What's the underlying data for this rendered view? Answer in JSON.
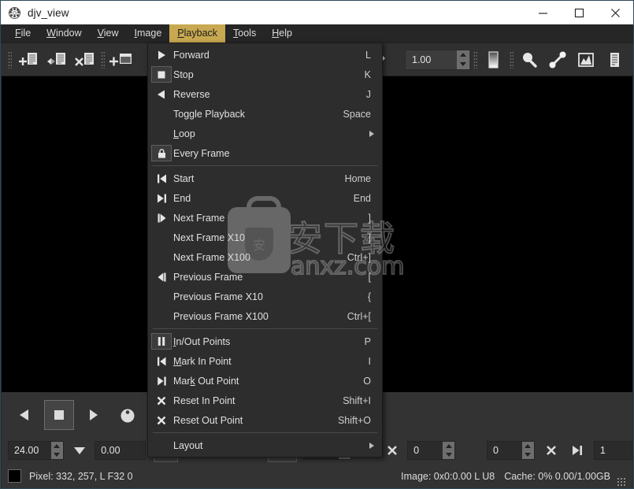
{
  "window": {
    "title": "djv_view",
    "icon": "film-reel-icon",
    "minimize_label": "—",
    "maximize_label": "□",
    "close_label": "✕"
  },
  "menubar": {
    "items": [
      {
        "label": "File",
        "mnemonic": "F",
        "active": false
      },
      {
        "label": "Window",
        "mnemonic": "W",
        "active": false
      },
      {
        "label": "View",
        "mnemonic": "V",
        "active": false
      },
      {
        "label": "Image",
        "mnemonic": "I",
        "active": false
      },
      {
        "label": "Playback",
        "mnemonic": "P",
        "active": true
      },
      {
        "label": "Tools",
        "mnemonic": "T",
        "active": false
      },
      {
        "label": "Help",
        "mnemonic": "H",
        "active": false
      }
    ]
  },
  "toolbar": {
    "zoom_value": "1.00",
    "buttons": [
      {
        "name": "add-file-icon"
      },
      {
        "name": "reload-file-icon"
      },
      {
        "name": "close-file-icon"
      },
      {
        "name": "new-window-icon"
      },
      {
        "name": "color-picker-icon"
      },
      {
        "name": "gradient-icon"
      },
      {
        "name": "magnify-icon"
      },
      {
        "name": "color-pick-tool-icon"
      },
      {
        "name": "histogram-icon"
      },
      {
        "name": "info-icon"
      }
    ]
  },
  "playback_menu": {
    "items": [
      {
        "label": "Forward",
        "shortcut": "L",
        "icon": "play-forward-icon",
        "mnemonic": "",
        "boxed": false,
        "submenu": false
      },
      {
        "label": "Stop",
        "shortcut": "K",
        "icon": "stop-icon",
        "mnemonic": "",
        "boxed": true,
        "submenu": false
      },
      {
        "label": "Reverse",
        "shortcut": "J",
        "icon": "play-reverse-icon",
        "mnemonic": "",
        "boxed": false,
        "submenu": false
      },
      {
        "label": "Toggle Playback",
        "shortcut": "Space",
        "icon": "",
        "mnemonic": "",
        "boxed": false,
        "submenu": false
      },
      {
        "label": "Loop",
        "shortcut": "",
        "icon": "",
        "mnemonic": "L",
        "boxed": false,
        "submenu": true
      },
      {
        "label": "Every Frame",
        "shortcut": "",
        "icon": "lock-icon",
        "mnemonic": "",
        "boxed": true,
        "submenu": false
      },
      {
        "separator": true
      },
      {
        "label": "Start",
        "shortcut": "Home",
        "icon": "skip-start-icon",
        "mnemonic": "",
        "boxed": false,
        "submenu": false
      },
      {
        "label": "End",
        "shortcut": "End",
        "icon": "skip-end-icon",
        "mnemonic": "",
        "boxed": false,
        "submenu": false
      },
      {
        "label": "Next Frame",
        "shortcut": "]",
        "icon": "next-frame-icon",
        "mnemonic": "",
        "boxed": false,
        "submenu": false
      },
      {
        "label": "Next Frame X10",
        "shortcut": "]",
        "icon": "",
        "mnemonic": "",
        "boxed": false,
        "submenu": false
      },
      {
        "label": "Next Frame X100",
        "shortcut": "Ctrl+]",
        "icon": "",
        "mnemonic": "",
        "boxed": false,
        "submenu": false
      },
      {
        "label": "Previous Frame",
        "shortcut": "[",
        "icon": "prev-frame-icon",
        "mnemonic": "",
        "boxed": false,
        "submenu": false
      },
      {
        "label": "Previous Frame X10",
        "shortcut": "{",
        "icon": "",
        "mnemonic": "",
        "boxed": false,
        "submenu": false
      },
      {
        "label": "Previous Frame X100",
        "shortcut": "Ctrl+[",
        "icon": "",
        "mnemonic": "",
        "boxed": false,
        "submenu": false
      },
      {
        "separator": true
      },
      {
        "label": "In/Out Points",
        "shortcut": "P",
        "icon": "pause-icon",
        "mnemonic": "I",
        "boxed": true,
        "submenu": false
      },
      {
        "label": "Mark In Point",
        "shortcut": "I",
        "icon": "mark-in-icon",
        "mnemonic": "M",
        "boxed": false,
        "submenu": false
      },
      {
        "label": "Mark Out Point",
        "shortcut": "O",
        "icon": "mark-out-icon",
        "mnemonic": "k",
        "boxed": false,
        "submenu": false
      },
      {
        "label": "Reset In Point",
        "shortcut": "Shift+I",
        "icon": "reset-x-icon",
        "mnemonic": "",
        "boxed": false,
        "submenu": false
      },
      {
        "label": "Reset Out Point",
        "shortcut": "Shift+O",
        "icon": "reset-x-icon",
        "mnemonic": "",
        "boxed": false,
        "submenu": false
      },
      {
        "separator": true
      },
      {
        "label": "Layout",
        "shortcut": "",
        "icon": "",
        "mnemonic": "",
        "boxed": false,
        "submenu": true
      }
    ]
  },
  "playback_bar": {
    "buttons": [
      {
        "name": "reverse-button",
        "selected": false
      },
      {
        "name": "stop-button",
        "selected": true
      },
      {
        "name": "forward-button",
        "selected": false
      },
      {
        "name": "record-button",
        "selected": false
      },
      {
        "name": "start-button",
        "selected": false
      }
    ]
  },
  "lower_bar": {
    "fps_value": "24.00",
    "speed_value": "0.00",
    "lock_icon": "lock-icon",
    "loop_icon": "loop-icon",
    "inout_icon": "pause-icon",
    "frame_value": "0",
    "in_point_value": "0",
    "out_point_value": "0",
    "duration_value": "1",
    "mark_in_icon": "mark-in-icon",
    "reset_in_icon": "reset-x-icon",
    "reset_out_icon": "reset-x-icon",
    "mark_out_icon": "mark-out-icon"
  },
  "statusbar": {
    "pixel_text": "Pixel: 332, 257, L F32 0",
    "image_text": "Image: 0x0:0.00 L U8",
    "cache_text": "Cache: 0% 0.00/1.00GB"
  },
  "watermark": {
    "cn_text": "安下载",
    "url_text": "anxz.com",
    "badge_char": "安"
  },
  "colors": {
    "accent": "#c8a951",
    "titlebar_bg": "#ffffff",
    "menubar_bg": "#262626",
    "toolbar_bg": "#303030",
    "panel_bg": "#333333",
    "menu_bg": "#2d2d2d",
    "viewport_bg": "#000000",
    "text": "#dcdcdc"
  }
}
